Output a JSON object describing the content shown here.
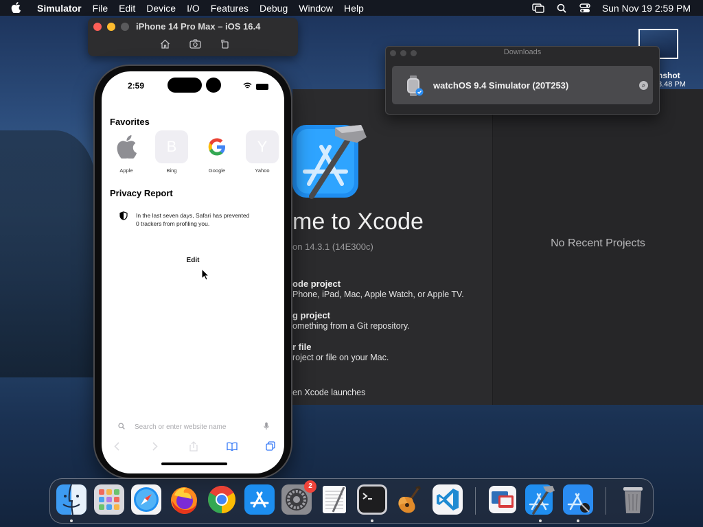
{
  "menubar": {
    "app_name": "Simulator",
    "items": [
      "File",
      "Edit",
      "Device",
      "I/O",
      "Features",
      "Debug",
      "Window",
      "Help"
    ],
    "clock": "Sun Nov 19  2:59 PM"
  },
  "simulator": {
    "title": "iPhone 14 Pro Max – iOS 16.4",
    "tools": [
      "home-icon",
      "screenshot-icon",
      "rotate-icon"
    ]
  },
  "phone": {
    "time": "2:59",
    "favorites_title": "Favorites",
    "favorites": [
      {
        "label": "Apple",
        "letter": ""
      },
      {
        "label": "Bing",
        "letter": "B"
      },
      {
        "label": "Google",
        "letter": ""
      },
      {
        "label": "Yahoo",
        "letter": "Y"
      }
    ],
    "privacy_title": "Privacy Report",
    "privacy_line1": "In the last seven days, Safari has prevented",
    "privacy_line2": "0 trackers from profiling you.",
    "edit_label": "Edit",
    "search_placeholder": "Search or enter website name"
  },
  "xcode": {
    "welcome": "me to Xcode",
    "version": "on 14.3.1 (14E300c)",
    "actions": [
      {
        "title": "ode project",
        "subtitle": "Phone, iPad, Mac, Apple Watch, or Apple TV."
      },
      {
        "title": "g project",
        "subtitle": "omething from a Git repository."
      },
      {
        "title": "r file",
        "subtitle": "roject or file on your Mac."
      }
    ],
    "launch_text": "en Xcode launches",
    "no_recent": "No Recent Projects"
  },
  "downloads": {
    "title": "Downloads",
    "item": "watchOS 9.4 Simulator (20T253)"
  },
  "desktop": {
    "screenshot_label_1": "nshot",
    "screenshot_label_2": "3.48 PM"
  },
  "dock": {
    "settings_badge": "2",
    "apps": [
      "Finder",
      "Launchpad",
      "Safari",
      "Firefox",
      "Chrome",
      "App Store",
      "System Settings",
      "TextEdit",
      "Terminal",
      "GarageBand",
      "Visual Studio Code",
      "Screen Sharing",
      "Xcode",
      "Instruments",
      "Trash"
    ]
  },
  "colors": {
    "accent_blue": "#3478f6",
    "badge_red": "#f0433a",
    "window_dark": "#2b2b2d"
  }
}
